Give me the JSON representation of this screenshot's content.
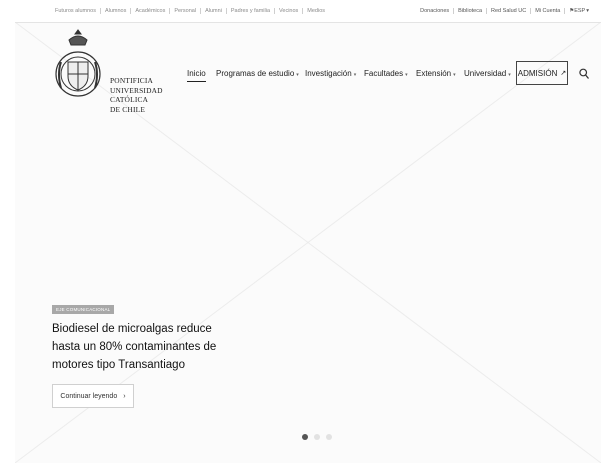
{
  "topbar": {
    "left": [
      "Futuros alumnos",
      "Alumnos",
      "Académicos",
      "Personal",
      "Alumni",
      "Padres y familia",
      "Vecinos",
      "Medios"
    ],
    "right": [
      "Donaciones",
      "Biblioteca",
      "Red Salud UC",
      "Mi Cuenta"
    ],
    "lang": "ESP"
  },
  "brand": {
    "line1": "PONTIFICIA",
    "line2": "UNIVERSIDAD",
    "line3": "CATÓLICA",
    "line4": "DE CHILE"
  },
  "nav": {
    "items": [
      "Inicio",
      "Programas de estudio",
      "Investigación",
      "Facultades",
      "Extensión",
      "Universidad"
    ],
    "admision": "ADMISIÓN"
  },
  "hero": {
    "tag": "EJE COMUNICACIONAL",
    "headline": "Biodiesel de microalgas reduce hasta un 80% contaminantes de motores tipo Transantiago",
    "cta": "Continuar leyendo"
  },
  "carousel": {
    "active_index": 0,
    "total": 3
  },
  "colors": {
    "text": "#222222",
    "muted": "#8a8a8a",
    "border": "#444444"
  },
  "icons": {
    "search": "search-icon",
    "external": "external-link-icon",
    "flag": "flag-icon",
    "caret": "chevron-down-icon",
    "chevron": "chevron-right-icon"
  }
}
